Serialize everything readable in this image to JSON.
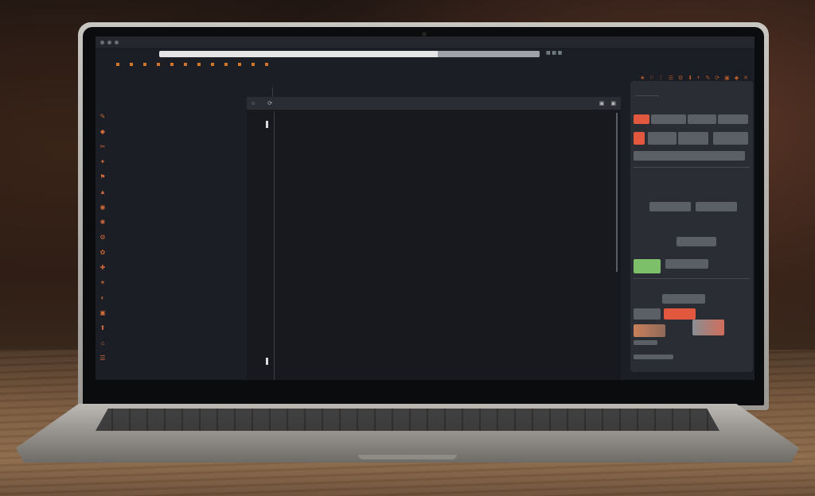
{
  "browser": {
    "tab_title": "",
    "bookmarks": [
      "",
      "",
      "",
      "",
      "",
      "",
      "",
      "",
      "",
      "",
      "",
      ""
    ],
    "toolbar_icons": [
      "★",
      "⌂",
      "⋮",
      "☰",
      "⚙",
      "⬇",
      "◐",
      "✎",
      "⟳",
      "▣",
      "◆",
      "✕"
    ]
  },
  "left_sidebar": {
    "icons": [
      "✎",
      "◆",
      "✂",
      "✦",
      "⚑",
      "▲",
      "◉",
      "✱",
      "⚙",
      "✿",
      "✚",
      "✶",
      "◐",
      "▣",
      "⬆",
      "⌂",
      "☰"
    ]
  },
  "editor": {
    "header_icons": [
      "○",
      "▣",
      "⟳"
    ],
    "header_title": "",
    "paragraphs": [
      "",
      "",
      "",
      "",
      ""
    ]
  },
  "right_panel": {
    "title": "",
    "rows": [
      {
        "label": "",
        "color": "#e2583f"
      },
      {
        "label": "",
        "color": "#7cc06a"
      },
      {
        "label": "",
        "color": "#e2583f"
      }
    ]
  },
  "colors": {
    "accent_orange": "#d2752a",
    "accent_red": "#e2583f",
    "accent_green": "#7cc06a",
    "editor_bg": "#17191e",
    "screen_bg": "#1b1e24"
  }
}
